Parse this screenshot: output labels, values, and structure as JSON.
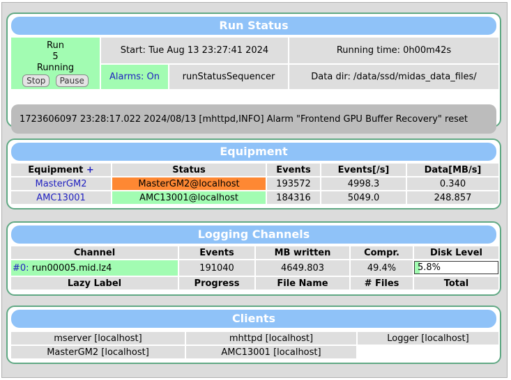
{
  "run_status": {
    "title": "Run Status",
    "run_label": "Run",
    "run_number": "5",
    "state": "Running",
    "stop_label": "Stop",
    "pause_label": "Pause",
    "start": "Start: Tue Aug 13 23:27:41 2024",
    "running_time": "Running time: 0h00m42s",
    "alarms": "Alarms: On",
    "sequencer": "runStatusSequencer",
    "data_dir": "Data dir: /data/ssd/midas_data_files/",
    "message": "1723606097 23:28:17.022 2024/08/13 [mhttpd,INFO] Alarm \"Frontend GPU Buffer Recovery\" reset"
  },
  "equipment": {
    "title": "Equipment",
    "headers": [
      "Equipment",
      "Status",
      "Events",
      "Events[/s]",
      "Data[MB/s]"
    ],
    "add_symbol": "+",
    "rows": [
      {
        "name": "MasterGM2",
        "status": "MasterGM2@localhost",
        "events": "193572",
        "rate": "4998.3",
        "data": "0.340"
      },
      {
        "name": "AMC13001",
        "status": "AMC13001@localhost",
        "events": "184316",
        "rate": "5049.0",
        "data": "248.857"
      }
    ],
    "status_colors": [
      "#fe8833",
      "#a2fcb2"
    ]
  },
  "logging": {
    "title": "Logging Channels",
    "headers": [
      "Channel",
      "Events",
      "MB written",
      "Compr.",
      "Disk Level"
    ],
    "channel": {
      "id": "#0:",
      "file": "run00005.mid.lz4",
      "events": "191040",
      "mb": "4649.803",
      "compr": "49.4%",
      "disk": "5.8%"
    },
    "disk_level_fraction": 0.058,
    "lazy_headers": [
      "Lazy Label",
      "Progress",
      "File Name",
      "# Files",
      "Total"
    ]
  },
  "clients": {
    "title": "Clients",
    "items": [
      "mserver [localhost]",
      "mhttpd [localhost]",
      "Logger [localhost]",
      "MasterGM2 [localhost]",
      "AMC13001 [localhost]"
    ]
  }
}
